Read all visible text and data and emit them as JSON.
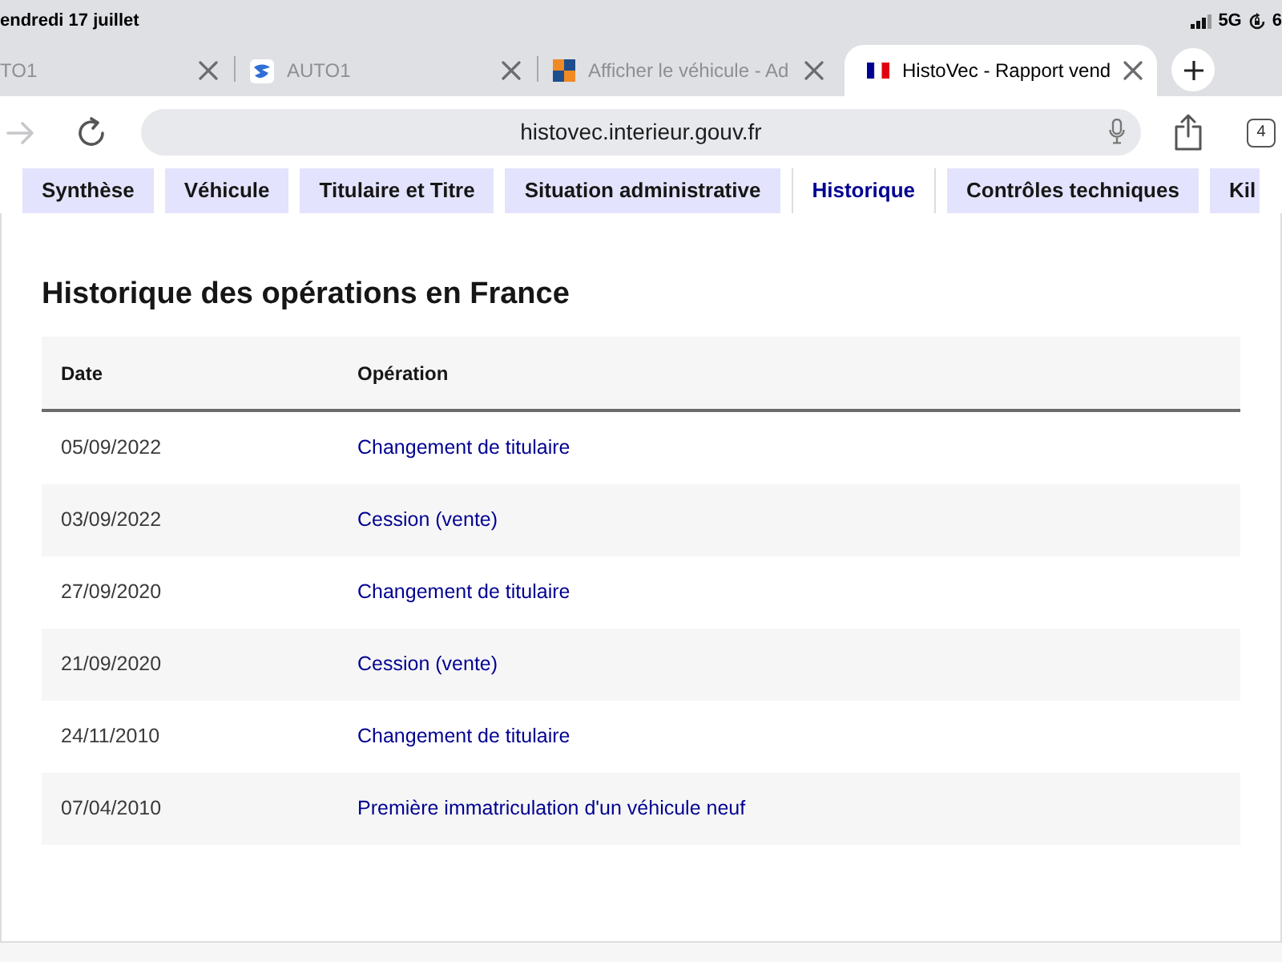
{
  "status_bar": {
    "date": "endredi 17 juillet",
    "network": "5G",
    "battery": "6"
  },
  "browser_tabs": [
    {
      "title": "TO1",
      "selected": false
    },
    {
      "title": "AUTO1",
      "selected": false
    },
    {
      "title": "Afficher le véhicule - Ad",
      "selected": false
    },
    {
      "title": "HistoVec - Rapport vend",
      "selected": true
    }
  ],
  "toolbar": {
    "forward_disabled": true,
    "url": "histovec.interieur.gouv.fr",
    "tab_count": "4"
  },
  "nav_tabs": [
    {
      "label": "Synthèse",
      "selected": false
    },
    {
      "label": "Véhicule",
      "selected": false
    },
    {
      "label": "Titulaire et Titre",
      "selected": false
    },
    {
      "label": "Situation administrative",
      "selected": false
    },
    {
      "label": "Historique",
      "selected": true
    },
    {
      "label": "Contrôles techniques",
      "selected": false
    },
    {
      "label": "Kil",
      "selected": false
    }
  ],
  "history": {
    "title": "Historique des opérations en France",
    "columns": [
      "Date",
      "Opération"
    ],
    "rows": [
      {
        "date": "05/09/2022",
        "operation": "Changement de titulaire"
      },
      {
        "date": "03/09/2022",
        "operation": "Cession (vente)"
      },
      {
        "date": "27/09/2020",
        "operation": "Changement de titulaire"
      },
      {
        "date": "21/09/2020",
        "operation": "Cession (vente)"
      },
      {
        "date": "24/11/2010",
        "operation": "Changement de titulaire"
      },
      {
        "date": "07/04/2010",
        "operation": "Première immatriculation d'un véhicule neuf"
      }
    ]
  }
}
